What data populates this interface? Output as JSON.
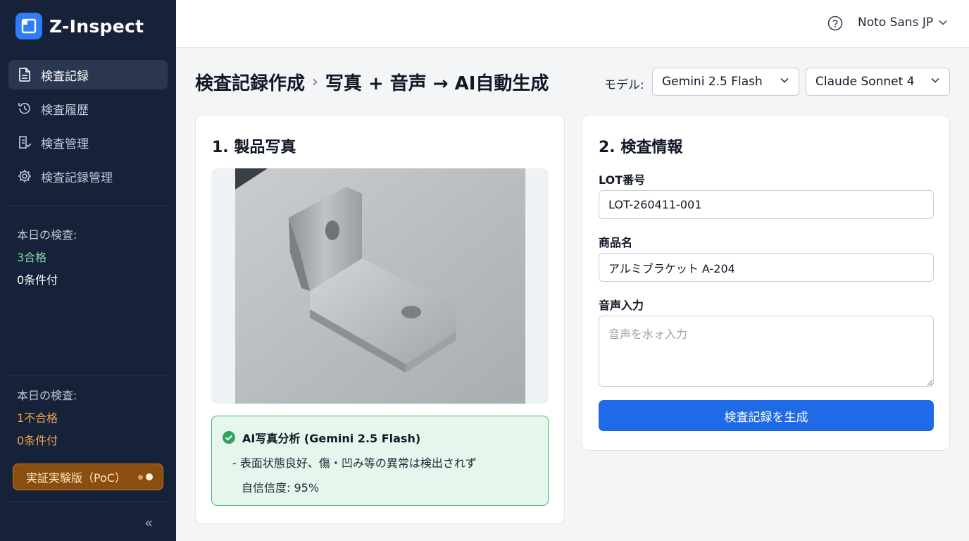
{
  "app": {
    "name": "Z-Inspect"
  },
  "sidebar": {
    "items": [
      {
        "label": "検査記録",
        "icon": "document-icon",
        "active": true
      },
      {
        "label": "検査履歴",
        "icon": "history-icon",
        "active": false
      },
      {
        "label": "検査管理",
        "icon": "clipboard-icon",
        "active": false
      },
      {
        "label": "検査記録管理",
        "icon": "gear-icon",
        "active": false
      }
    ],
    "stats_top": {
      "label": "本日の検査:",
      "pass": "3合格",
      "conditional": "0条件付"
    },
    "stats_bottom": {
      "label": "本日の検査:",
      "fail": "1不合格",
      "conditional": "0条件付"
    },
    "poc_badge": "実証実験版（PoC）",
    "collapse_icon": "«"
  },
  "topbar": {
    "font_select": "Noto Sans JP",
    "help_icon": "help-circle-icon"
  },
  "header": {
    "title_main": "検査記録作成",
    "title_separator": "›",
    "title_sub": "写真 + 音声 → AI自動生成",
    "model_label": "モデル:",
    "model_1": "Gemini 2.5 Flash",
    "model_2": "Claude Sonnet 4"
  },
  "photo_card": {
    "title": "1. 製品写真",
    "ai_title": "AI写真分析 (Gemini 2.5 Flash)",
    "ai_result": "- 表面状態良好、傷・凹み等の異常は検出されず",
    "ai_confidence": "自信信度: 95%"
  },
  "info_card": {
    "title": "2. 検査情報",
    "lot_label": "LOT番号",
    "lot_value": "LOT-260411-001",
    "product_label": "商品名",
    "product_value": "アルミブラケット A-204",
    "voice_label": "音声入力",
    "voice_placeholder": "音声を水ォ入力",
    "generate_button": "検査記録を生成"
  },
  "colors": {
    "sidebar_bg": "#16213a",
    "accent": "#1f6ae6",
    "success": "#3dbb6e",
    "warning": "#f2a44a"
  }
}
